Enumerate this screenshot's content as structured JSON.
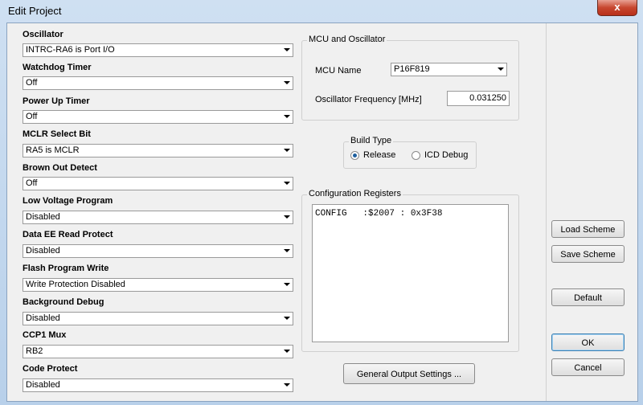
{
  "window": {
    "title": "Edit Project",
    "close_label": "x"
  },
  "config_fields": [
    {
      "label": "Oscillator",
      "value": "INTRC-RA6 is Port I/O"
    },
    {
      "label": "Watchdog Timer",
      "value": "Off"
    },
    {
      "label": "Power Up Timer",
      "value": "Off"
    },
    {
      "label": "MCLR Select Bit",
      "value": "RA5 is MCLR"
    },
    {
      "label": "Brown Out Detect",
      "value": "Off"
    },
    {
      "label": "Low Voltage Program",
      "value": "Disabled"
    },
    {
      "label": "Data EE Read Protect",
      "value": "Disabled"
    },
    {
      "label": "Flash Program Write",
      "value": "Write Protection Disabled"
    },
    {
      "label": "Background Debug",
      "value": "Disabled"
    },
    {
      "label": "CCP1 Mux",
      "value": "RB2"
    },
    {
      "label": "Code Protect",
      "value": "Disabled"
    }
  ],
  "mcu": {
    "group_title": "MCU and Oscillator",
    "name_label": "MCU Name",
    "name_value": "P16F819",
    "freq_label": "Oscillator Frequency [MHz]",
    "freq_value": "0.031250"
  },
  "build": {
    "group_title": "Build Type",
    "release_label": "Release",
    "icd_label": "ICD Debug",
    "selected": "Release"
  },
  "registers": {
    "group_title": "Configuration Registers",
    "text": "CONFIG   :$2007 : 0x3F38"
  },
  "buttons": {
    "general_output": "General Output Settings ...",
    "load_scheme": "Load Scheme",
    "save_scheme": "Save Scheme",
    "default": "Default",
    "ok": "OK",
    "cancel": "Cancel"
  }
}
